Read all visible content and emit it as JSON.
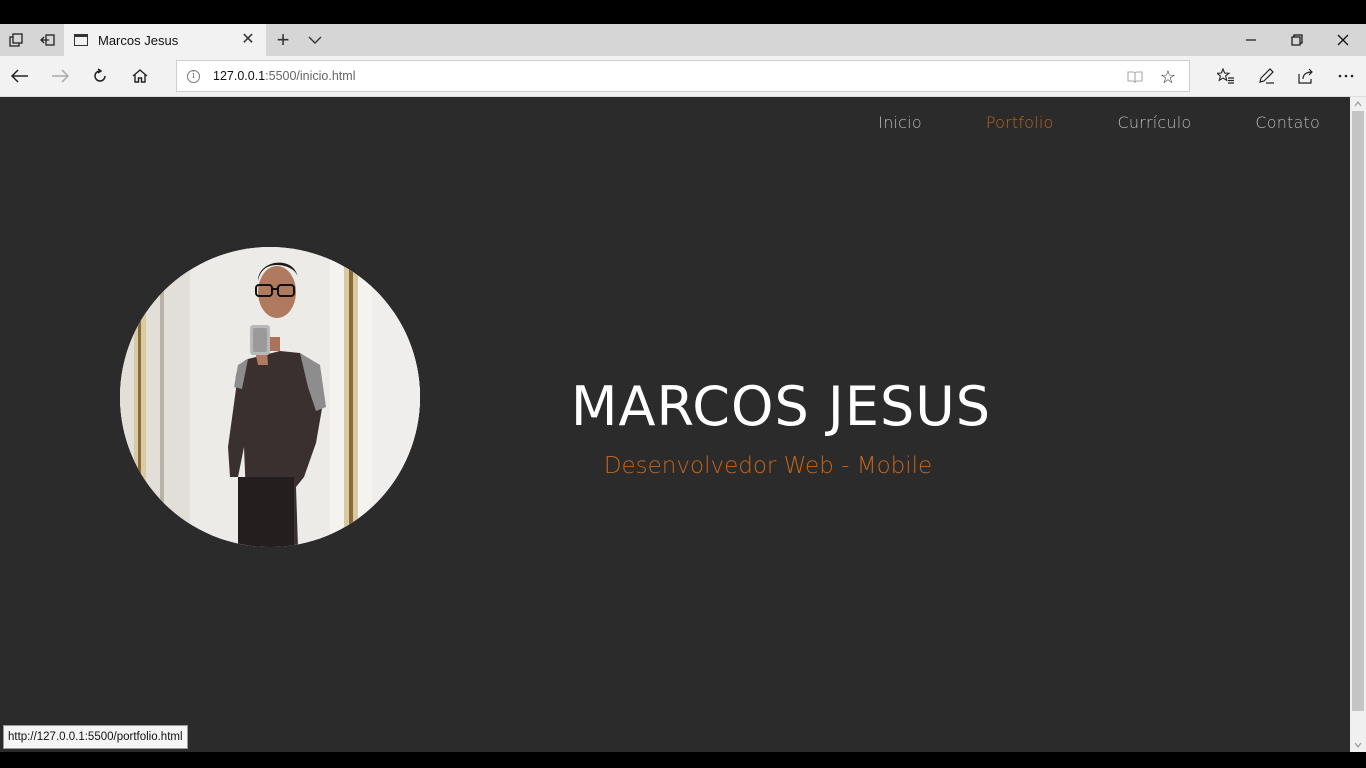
{
  "browser": {
    "tab_title": "Marcos Jesus",
    "url_host": "127.0.0.1",
    "url_rest": ":5500/inicio.html",
    "status_url": "http://127.0.0.1:5500/portfolio.html",
    "close_glyph": "✕",
    "new_tab_glyph": "+",
    "info_glyph": "i",
    "star_glyph": "☆"
  },
  "site": {
    "nav": [
      {
        "label": "Inicio",
        "active": false
      },
      {
        "label": "Portfolio",
        "active": true
      },
      {
        "label": "Currículo",
        "active": false
      },
      {
        "label": "Contato",
        "active": false
      }
    ],
    "name": "MARCOS JESUS",
    "tagline": "Desenvolvedor Web - Mobile"
  },
  "colors": {
    "page_bg": "#2b2b2b",
    "accent": "#c2651d",
    "nav_text": "#b9b9b9",
    "name_text": "#ffffff"
  }
}
